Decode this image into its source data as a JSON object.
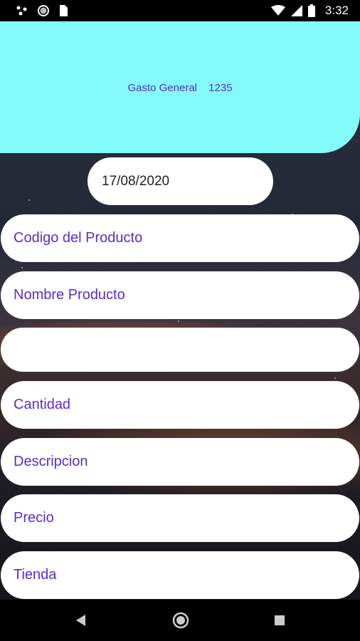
{
  "status_bar": {
    "time": "3:32",
    "icons": [
      "notification-dots-icon",
      "circle-icon",
      "sim-card-icon",
      "wifi-icon",
      "signal-icon",
      "battery-icon"
    ]
  },
  "header": {
    "label": "Gasto General",
    "number": "1235",
    "background_color": "#84fbfb",
    "text_color": "#5b2bd3"
  },
  "date_field": {
    "value": "17/08/2020"
  },
  "form": {
    "fields": [
      {
        "placeholder": "Codigo del Producto"
      },
      {
        "placeholder": "Nombre Producto"
      },
      {
        "placeholder": ""
      },
      {
        "placeholder": "Cantidad"
      },
      {
        "placeholder": "Descripcion"
      },
      {
        "placeholder": "Precio"
      },
      {
        "placeholder": "Tienda"
      }
    ]
  },
  "nav_bar": {
    "icons": [
      "back-icon",
      "home-icon",
      "recents-icon"
    ]
  }
}
